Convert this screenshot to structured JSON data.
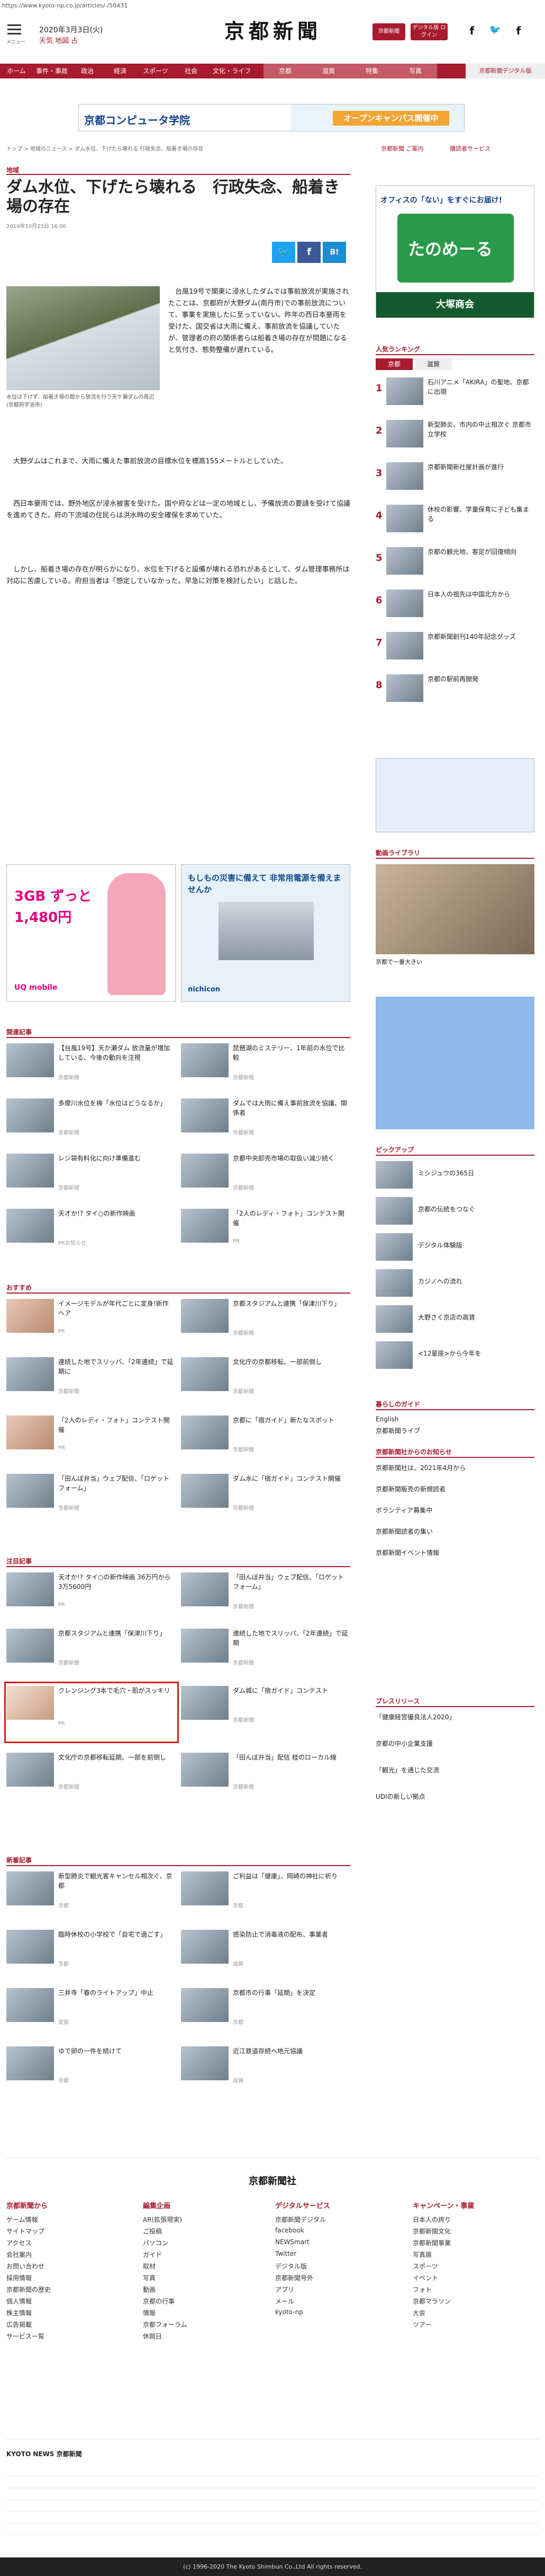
{
  "url": "https://www.kyoto-np.co.jp/articles/-/50431",
  "header": {
    "menu_label": "メニュー",
    "date": "2020年3月3日(火)",
    "weather": "天気  地図  占",
    "logo": "京都新聞",
    "btn_login": "京都新聞",
    "btn_digital": "デジタル版 ログイン",
    "sns": [
      "f",
      "🐦",
      "f"
    ]
  },
  "nav": [
    {
      "label": "ホーム",
      "style": "main"
    },
    {
      "label": "事件・事故",
      "style": "main"
    },
    {
      "label": "政治",
      "style": "main"
    },
    {
      "label": "経済",
      "style": "main"
    },
    {
      "label": "スポーツ",
      "style": "main"
    },
    {
      "label": "社会",
      "style": "main"
    },
    {
      "label": "文化・ライフ",
      "style": "main"
    },
    {
      "label": "京都",
      "style": "pale"
    },
    {
      "label": "滋賀",
      "style": "pale"
    },
    {
      "label": "特集",
      "style": "pale"
    },
    {
      "label": "写真",
      "style": "pale"
    },
    {
      "label": "京都新聞デジタル版",
      "style": "wh"
    }
  ],
  "ad_banner": {
    "name": "京都コンピュータ学院",
    "cta": "オープンキャンパス開催中"
  },
  "breadcrumb": "トップ > 地域のニュース > ダム水位、下げたら壊れる 行政失念、船着き場の存在",
  "right_top": {
    "link1": "京都新聞 ご案内",
    "link2": "購読者サービス"
  },
  "right_ad": {
    "line1": "オフィスの「ない」をすぐにお届け!",
    "brand": "たのめーる",
    "company": "大塚商会"
  },
  "article": {
    "category": "地域",
    "title": "ダム水位、下げたら壊れる　行政失念、船着き場の存在",
    "timestamp": "2019年10月23日 16:00",
    "share": [
      "🐦",
      "f",
      "B!"
    ],
    "caption": "水位は下げず、船着き場の間から放流を行う天ケ瀬ダムの周辺(京都府宇治市)",
    "paragraphs": [
      "　台風19号で関東に浸水したダムでは事前放流が実施されたことは、京都府が大野ダム(南丹市)での事前放流について、事業を実施したに至っていない。昨年の西日本豪雨を受けた、国交省は大雨に備え、事前放流を協議していたが、管理者の府の関係者らは船着き場の存在が問題になると気付き、態勢整備が遅れている。",
      "　大野ダムはこれまで、大雨に備えた事前放流の目標水位を標高155メートルとしていた。",
      "　西日本豪雨では、野外地区が浸水被害を受けた。国や府などは一定の地域とし、予備放流の要請を受けて協議を進めてきた。府の下流域の住民らは洪水時の安全確保を求めていた。",
      "　しかし、船着き場の存在が明らかになり、水位を下げると設備が壊れる恐れがあるとして、ダム管理事務所は対応に苦慮している。府担当者は「想定していなかった。早急に対策を検討したい」と話した。"
    ]
  },
  "ads_bottom": [
    {
      "headline": "3GB ずっと 1,480円",
      "brand": "UQ mobile"
    },
    {
      "headline": "もしもの災害に備えて 非常用電源を備えませんか",
      "brand": "nichicon"
    }
  ],
  "related": {
    "heading": "関連記事",
    "items": [
      {
        "t": "【台風19号】天か瀬ダム 放流量が増加している、今後の動向を注視",
        "s": "京都新聞"
      },
      {
        "t": "琵琶湖のミステリー、1年前の水位で比較",
        "s": "京都新聞"
      },
      {
        "t": "多摩川水位を検「水位はどうなるか」",
        "s": "京都新聞"
      },
      {
        "t": "ダムでは大雨に備え事前放流を協議、関係者",
        "s": "京都新聞"
      },
      {
        "t": "レジ袋有料化に向け準備進む",
        "s": "京都新聞"
      },
      {
        "t": "京都中央卸売市場の取扱い減少続く",
        "s": "京都新聞"
      },
      {
        "t": "天才か!? タイ○の新作映画",
        "s": "PRお知らせ"
      },
      {
        "t": "「2人のレディ・フォト」コンテスト開催",
        "s": "PR"
      }
    ]
  },
  "recommend": {
    "heading": "おすすめ",
    "items": [
      {
        "t": "イメージモデルが年代ごとに変身!新作ヘア",
        "s": "PR"
      },
      {
        "t": "京都スタジアムと連携「保津川下り」",
        "s": "京都新聞"
      },
      {
        "t": "連続した地でスリッパ、「2年連続」で延期に",
        "s": "京都新聞"
      },
      {
        "t": "文化庁の京都移転、一部前倒し",
        "s": "京都新聞"
      },
      {
        "t": "「2人のレディ・フォト」コンテスト開催",
        "s": "PR"
      },
      {
        "t": "京都に「宿ガイド」新たなスポット",
        "s": "京都新聞"
      },
      {
        "t": "「田んぼ弁当」ウェブ配信、「ロゲットフォーム」",
        "s": "京都新聞"
      },
      {
        "t": "ダム水に「宿ガイド」コンテスト開催",
        "s": "京都新聞"
      }
    ]
  },
  "popular": {
    "heading": "注目記事",
    "items": [
      {
        "t": "天才か!? タイ○の新作映画 36万円から3万5600円",
        "s": "PR"
      },
      {
        "t": "「田んぼ弁当」ウェブ配信、「ロゲットフォーム」",
        "s": "京都新聞"
      },
      {
        "t": "京都スタジアムと連携「保津川下り」",
        "s": "京都新聞"
      },
      {
        "t": "連続した地でスリッパ、「2年連続」で延期",
        "s": "京都新聞"
      },
      {
        "t": "クレンジング3本で毛穴・肌がスッキリ",
        "s": "PR"
      },
      {
        "t": "ダム城に「宿ガイド」コンテスト",
        "s": "京都新聞"
      },
      {
        "t": "文化庁の京都移転延期、一部を前倒し",
        "s": "京都新聞"
      },
      {
        "t": "「田んぼ弁当」配信 桂のローカル線",
        "s": "京都新聞"
      }
    ]
  },
  "recent": {
    "heading": "新着記事",
    "items": [
      {
        "t": "新型肺炎で観光客キャンセル相次ぐ、京都",
        "s": "京都"
      },
      {
        "t": "ご利益は「健康」、岡崎の神社に祈り",
        "s": "京都"
      },
      {
        "t": "臨時休校の小学校で「自宅で過ごす」",
        "s": "京都"
      },
      {
        "t": "感染防止で消毒液の配布、事業者",
        "s": "滋賀"
      },
      {
        "t": "三井寺「春のライトアップ」中止",
        "s": "滋賀"
      },
      {
        "t": "京都市の行事「延期」を決定",
        "s": "京都"
      },
      {
        "t": "ゆで卵の一件を続けて",
        "s": "京都"
      },
      {
        "t": "近江鉄道存続へ地元協議",
        "s": "滋賀"
      }
    ]
  },
  "right_rank": {
    "heading": "人気ランキング",
    "tabs": [
      "京都",
      "滋賀"
    ],
    "items": [
      "石川アニメ「AKIRA」の聖地、京都に出現",
      "新型肺炎、市内の中止相次ぐ 京都市立学校",
      "京都新聞新社屋計画が進行",
      "休校の影響、学童保育に子ども集まる",
      "京都の観光地、客足が回復傾向",
      "日本人の祖先は中国北方から",
      "京都新聞創刊140年記念グッズ",
      "京都の駅前再開発"
    ]
  },
  "right_video": {
    "heading": "動画ライブラリ",
    "caption": "京都で一番大きい"
  },
  "right_pickup": {
    "heading": "ピックアップ",
    "items": [
      "ミシジュウの365日",
      "京都の伝統をつなぐ",
      "デジタル体験版",
      "カジノへの流れ",
      "大野さく京店の高賃",
      "<12星座>から今年を"
    ]
  },
  "right_guide": {
    "heading": "暮らしのガイド",
    "items": [
      "English",
      "京都新聞ライブ"
    ]
  },
  "right_notice": {
    "heading": "京都新聞社からのお知らせ",
    "items": [
      "京都新聞社は、2021年4月から",
      "京都新聞販売の新規読者",
      "ボランティア募集中",
      "京都新聞読者の集い",
      "京都新聞イベント情報"
    ]
  },
  "right_press": {
    "heading": "プレスリリース",
    "items": [
      "「健康経営優良法人2020」",
      "京都の中小企業支援",
      "「観光」を通じた交流",
      "UDIの新しい拠点"
    ]
  },
  "footer_brand": "京都新聞社",
  "footer": [
    {
      "h": "京都新聞から",
      "items": [
        "ゲーム情報",
        "サイトマップ",
        "アクセス",
        "会社案内",
        "お問い合わせ",
        "採用情報",
        "京都新聞の歴史",
        "個人情報",
        "株主情報",
        "広告掲載",
        "サービス一覧"
      ]
    },
    {
      "h": "編集企画",
      "items": [
        "AR(拡張現実)",
        "ご投稿",
        "パソコン",
        "ガイド",
        "取材",
        "写真",
        "動画",
        "京都の行事",
        "情報",
        "京都フォーラム",
        "休館日"
      ]
    },
    {
      "h": "デジタルサービス",
      "items": [
        "京都新聞デジタル",
        "facebook",
        "NEWSmart",
        "Twitter",
        "デジタル版",
        "京都新聞号外",
        "アプリ",
        "メール",
        "kyoto-np"
      ]
    },
    {
      "h": "キャンペーン・事業",
      "items": [
        "日本人の誇り",
        "京都新聞文化",
        "京都新聞事業",
        "写真展",
        "スポーツ",
        "イベント",
        "フォト",
        "京都マラソン",
        "大会",
        "ツアー"
      ]
    }
  ],
  "footer_sub": "KYOTO NEWS  京都新聞"
}
